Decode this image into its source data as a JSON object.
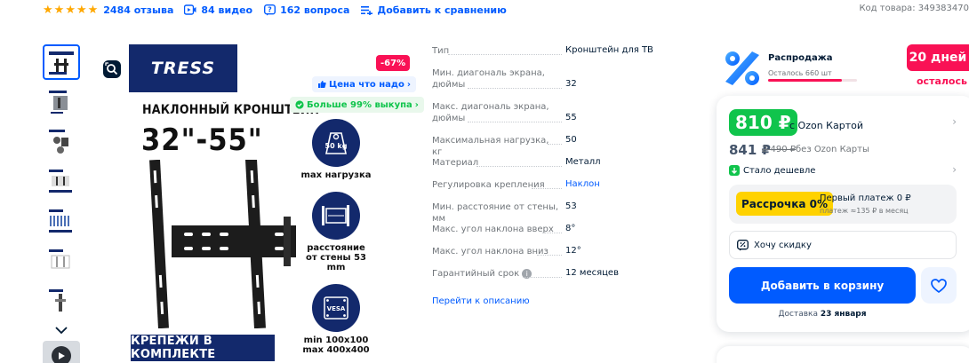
{
  "top_bar": {
    "rating_stars": 5,
    "reviews": "2484 отзыва",
    "videos": "84 видео",
    "questions": "162 вопроса",
    "compare": "Добавить к сравнению",
    "article": "Код товара: 349383470"
  },
  "gallery": {
    "thumbnail_count": 7,
    "main_image": {
      "brand": "TRESS",
      "mount_type": "НАКЛОННЫЙ КРОНШТЕЙН",
      "mount_size": "32\"-55\"",
      "kit_banner": "КРЕПЕЖИ В КОМПЛЕКТЕ",
      "discount": "-67%",
      "price_good": "Цена что надо",
      "buyout": "Больше 99% выкупа",
      "features": [
        {
          "icon": "weight-icon",
          "icon_text": "50 kg",
          "caption": "max нагрузка"
        },
        {
          "icon": "distance-icon",
          "caption": "расстояние от стены 53 mm"
        },
        {
          "icon": "vesa-icon",
          "icon_text": "VESA",
          "caption": "min 100x100 max 400x400"
        }
      ]
    }
  },
  "specs": {
    "rows": [
      {
        "name": "Тип",
        "value": "Кронштейн для ТВ"
      },
      {
        "name": "Мин. диагональ экрана, дюймы",
        "value": "32"
      },
      {
        "name": "Макс. диагональ экрана, дюймы",
        "value": "55"
      },
      {
        "name": "Максимальная нагрузка, кг",
        "value": "50"
      },
      {
        "name": "Материал",
        "value": "Металл"
      },
      {
        "name": "Регулировка крепления",
        "value": "Наклон"
      },
      {
        "name": "Мин. расстояние от стены, мм",
        "value": "53"
      },
      {
        "name": "Макс. угол наклона вверх",
        "value": "8°"
      },
      {
        "name": "Макс. угол наклона вниз",
        "value": "12°"
      },
      {
        "name": "Гарантийный срок",
        "value": "12 месяцев"
      }
    ],
    "to_description": "Перейти к описанию"
  },
  "sale": {
    "title": "Распродажа",
    "left": "Осталось 660 шт",
    "stock_fraction": 0.83,
    "days": "20 дней",
    "days_sub": "осталось"
  },
  "buy": {
    "ozon_price": "810 ₽",
    "ozon_price_label": "с Ozon Картой",
    "regular_price": "841 ₽",
    "old_price": "2 490 ₽",
    "no_card_label": "без Ozon Карты",
    "cheaper": "Стало дешевле",
    "installment_badge": "Рассрочка 0%",
    "installment_first": "Первый платеж 0 ₽",
    "installment_monthly": "платеж ≈135 ₽ в месяц",
    "want_discount": "Хочу скидку",
    "add_to_cart": "Добавить в корзину",
    "delivery_prefix": "Доставка",
    "delivery_date": "23 января"
  },
  "colors": {
    "accent": "#005bff",
    "sale": "#f91155",
    "green": "#10c44c",
    "brand_navy": "#13296c"
  }
}
